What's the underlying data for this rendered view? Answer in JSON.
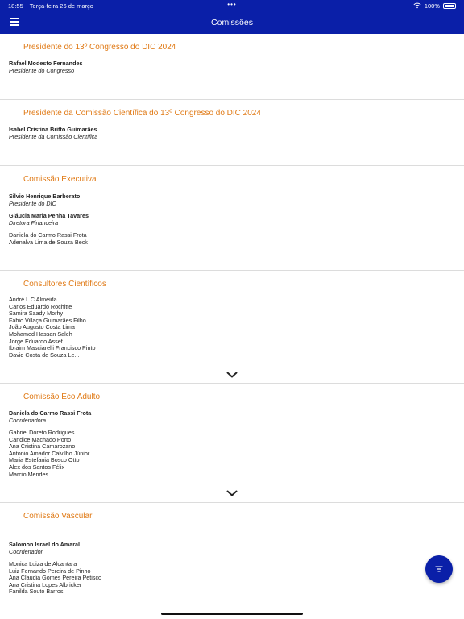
{
  "status": {
    "time": "18:55",
    "date": "Terça-feira 26 de março",
    "battery": "100%"
  },
  "navbar": {
    "title": "Comissões",
    "menu_icon": "hamburger-icon"
  },
  "sections": {
    "presidente": {
      "title": "Presidente do 13º Congresso do DIC 2024",
      "people": [
        {
          "name": "Rafael Modesto Fernandes",
          "role": "Presidente do Congresso"
        }
      ]
    },
    "cientifica": {
      "title": "Presidente da Comissão Científica do 13º Congresso do DIC 2024",
      "people": [
        {
          "name": "Isabel Cristina Britto Guimarães",
          "role": "Presidente da Comissão Científica"
        }
      ]
    },
    "executiva": {
      "title": "Comissão Executiva",
      "people": [
        {
          "name": "Silvio Henrique Barberato",
          "role": "Presidente do DIC"
        },
        {
          "name": "Gláucia Maria Penha Tavares",
          "role": "Diretora Financeira"
        }
      ],
      "members": [
        "Daniela do Carmo Rassi Frota",
        "Adenalva Lima de Souza Beck"
      ]
    },
    "consultores": {
      "title": "Consultores Científicos",
      "members": [
        "André L C Almeida",
        "Carlos Eduardo Rochitte",
        "Samira Saady Morhy",
        "Fábio Villaça Guimarães Filho",
        "João Augusto Costa Lima",
        "Mohamed Hassan Saleh",
        "Jorge Eduardo Assef",
        "Ibraim Masciarelli Francisco Pinto",
        "David Costa de Souza Le..."
      ]
    },
    "eco_adulto": {
      "title": "Comissão Eco Adulto",
      "people": [
        {
          "name": "Daniela do Carmo Rassi Frota",
          "role": "Coordenadora"
        }
      ],
      "members": [
        "Gabriel Doreto Rodrigues",
        "Candice Machado Porto",
        "Ana Cristina Camarozano",
        "Antonio Amador Calvilho Júnior",
        "Maria Estefania Bosco Otto",
        "Alex dos Santos Félix",
        "Marcio Mendes..."
      ]
    },
    "vascular": {
      "title": "Comissão Vascular",
      "people": [
        {
          "name": "Salomon Israel do Amaral",
          "role": "Coordenador"
        }
      ],
      "members": [
        "Monica Luiza de Alcantara",
        "Luiz Fernando Pereira de Pinho",
        "Ana Claudia Gomes Pereira Petisco",
        "Ana Cristina Lopes Albricker",
        "Fanilda Souto Barros"
      ]
    }
  },
  "icons": {
    "expand": "chevron-down-icon",
    "fab": "filter-list-icon",
    "wifi": "wifi-icon",
    "battery": "battery-icon"
  },
  "colors": {
    "brand": "#0a1fa8",
    "accent": "#e07a16"
  }
}
